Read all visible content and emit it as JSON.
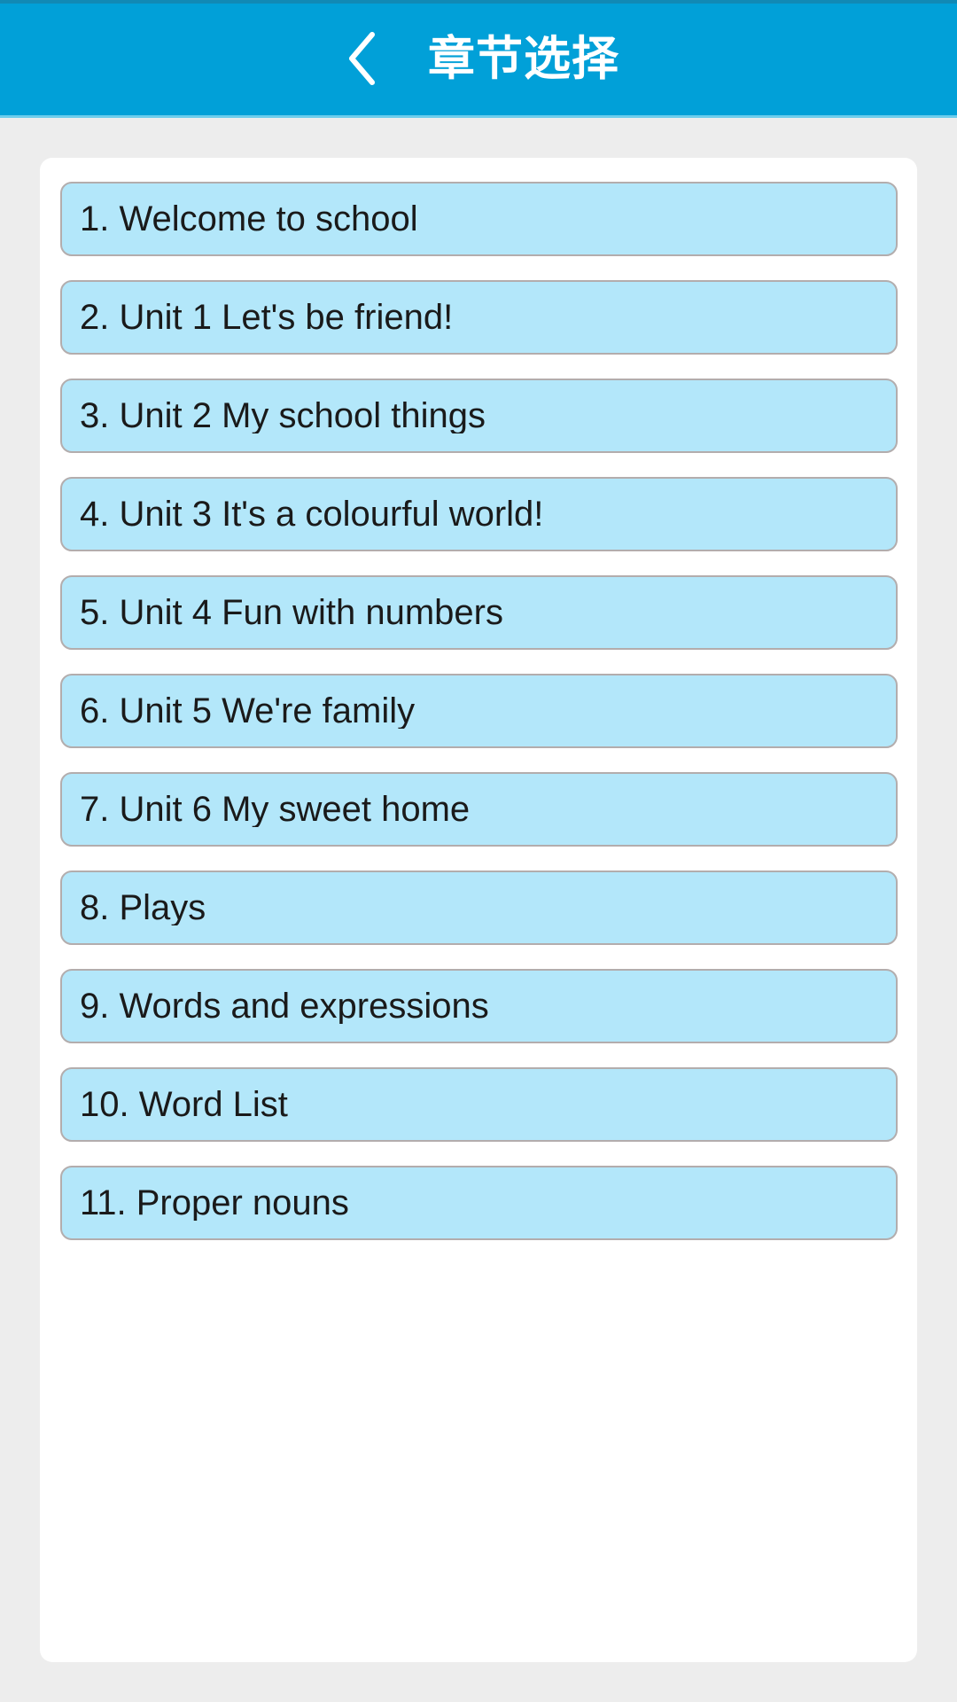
{
  "header": {
    "title": "章节选择",
    "back_icon": "chevron-left-icon",
    "background_color": "#01a0d8",
    "title_color": "#ffffff"
  },
  "colors": {
    "page_background": "#ededed",
    "card_background": "#ffffff",
    "item_fill": "#b3e7fa",
    "item_border": "#b3adad",
    "item_text": "#1a1a1a"
  },
  "chapter_list": {
    "items": [
      {
        "label": "1. Welcome to school"
      },
      {
        "label": "2. Unit 1 Let's be friend!"
      },
      {
        "label": "3. Unit 2 My school things"
      },
      {
        "label": "4. Unit 3 It's a colourful world!"
      },
      {
        "label": "5. Unit 4 Fun with numbers"
      },
      {
        "label": "6. Unit 5 We're family"
      },
      {
        "label": "7. Unit 6 My sweet home"
      },
      {
        "label": "8. Plays"
      },
      {
        "label": "9. Words and expressions"
      },
      {
        "label": "10. Word List"
      },
      {
        "label": "11. Proper nouns"
      }
    ]
  }
}
